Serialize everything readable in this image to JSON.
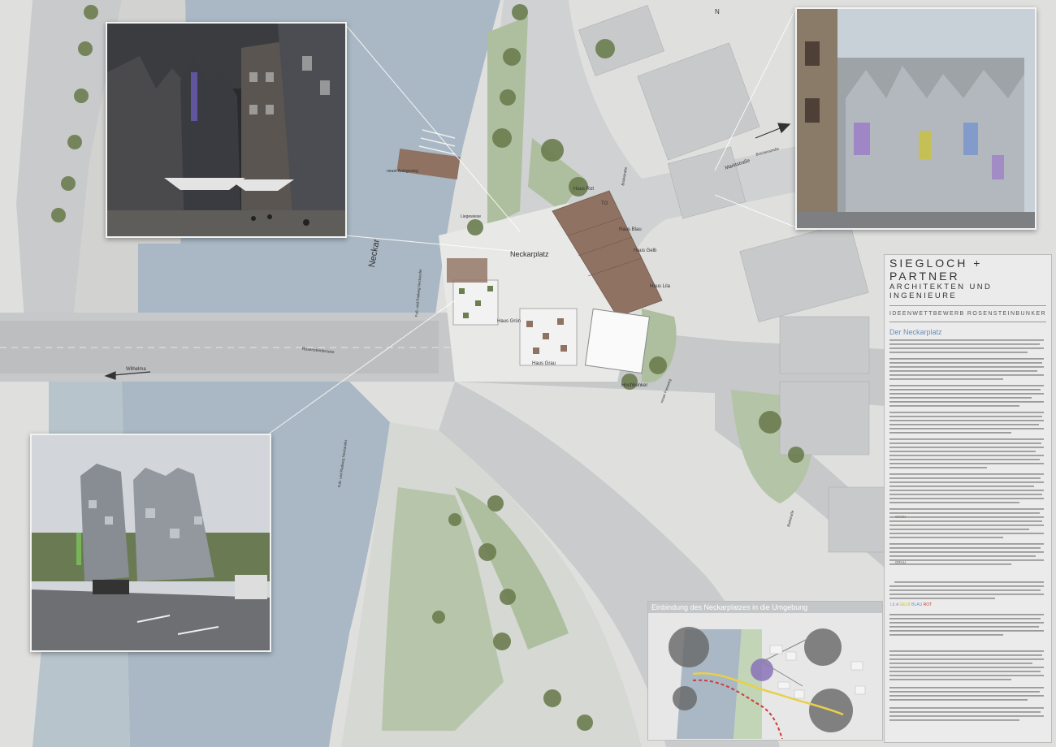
{
  "north_arrow": "N",
  "map_labels": {
    "neckar": "Neckar",
    "neckarplatz": "Neckarplatz",
    "haus_rot": "Haus Rot",
    "haus_blau": "Haus Blau",
    "haus_gelb": "Haus Gelb",
    "haus_lila": "Haus Lila",
    "haus_gruen": "Haus Grün",
    "haus_grau": "Haus Grau",
    "hochbunker": "Hochbunker",
    "liegewiese": "Liegewiese",
    "anlegesteg": "neuer Anlegesteg",
    "marktstrasse": "Marktstraße",
    "brueckenstrasse": "Brückenstraße",
    "rosensteinbruecke": "Rosensteinbrücke",
    "wilhelma": "Wilhelma",
    "fussweg_1": "Fuß- und Radweg Neckarufer",
    "fussweg_2": "Fuß- und Radweg Neckarufer",
    "fussweg_neu": "neuer Fussweg",
    "badstrasse": "Badstraße",
    "boeckstrasse": "Bodestraße",
    "to": "TO"
  },
  "panel": {
    "firm_name": "SIEGLOCH + PARTNER",
    "firm_subtitle": "ARCHITEKTEN UND INGENIEURE",
    "competition": "IDEENWETTBEWERB ROSENSTEINBUNKER",
    "section_title": "Der Neckarplatz",
    "color_line": {
      "lila": "LILA",
      "gelb": "GELB",
      "blau": "BLAU",
      "rot": "ROT"
    },
    "subheads": {
      "gruen": "GRÜN",
      "grau": "GRAU"
    }
  },
  "inset": {
    "title": "Einbindung des Neckarplatzes in die Umgebung"
  },
  "colors": {
    "water": "#a9b8c4",
    "road": "#c9cbcc",
    "ground": "#e3e4e2",
    "green": "#a8bd9a",
    "tree": "#6c7d4f",
    "roof": "#8f7262",
    "accent_blue": "#6b8fb8",
    "lila": "#b07fc8",
    "gelb": "#c9c23b",
    "blau": "#6d8fd0",
    "rot": "#c8403b"
  }
}
